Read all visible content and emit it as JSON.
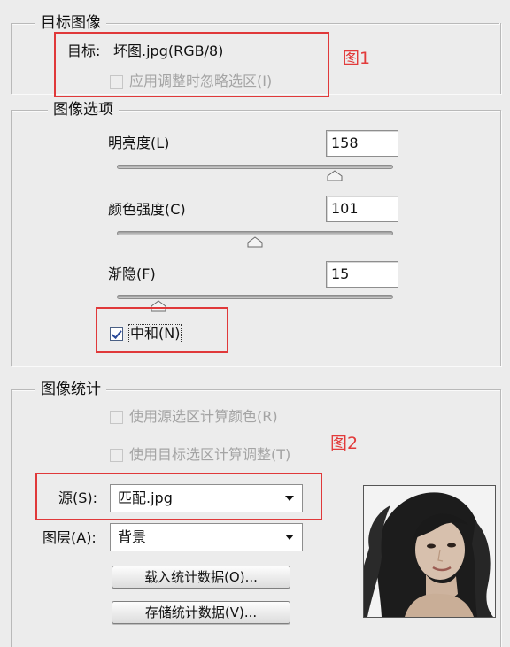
{
  "target_image": {
    "legend": "目标图像",
    "target_label": "目标:",
    "target_value": "坏图.jpg(RGB/8)",
    "ignore_selection_label": "应用调整时忽略选区(I)"
  },
  "image_options": {
    "legend": "图像选项",
    "luminance": {
      "label": "明亮度(L)",
      "value": "158",
      "slider_fraction": 0.79
    },
    "color_intensity": {
      "label": "颜色强度(C)",
      "value": "101",
      "slider_fraction": 0.5
    },
    "fade": {
      "label": "渐隐(F)",
      "value": "15",
      "slider_fraction": 0.15
    },
    "neutralize": {
      "label": "中和(N)",
      "checked": true
    }
  },
  "image_statistics": {
    "legend": "图像统计",
    "use_source_selection_label": "使用源选区计算颜色(R)",
    "use_target_selection_label": "使用目标选区计算调整(T)",
    "source_label": "源(S):",
    "source_value": "匹配.jpg",
    "layer_label": "图层(A):",
    "layer_value": "背景",
    "load_stats_button": "载入统计数据(O)...",
    "save_stats_button": "存储统计数据(V)..."
  },
  "annotations": {
    "fig1": "图1",
    "fig2": "图2",
    "box_color": "#e0393a"
  }
}
